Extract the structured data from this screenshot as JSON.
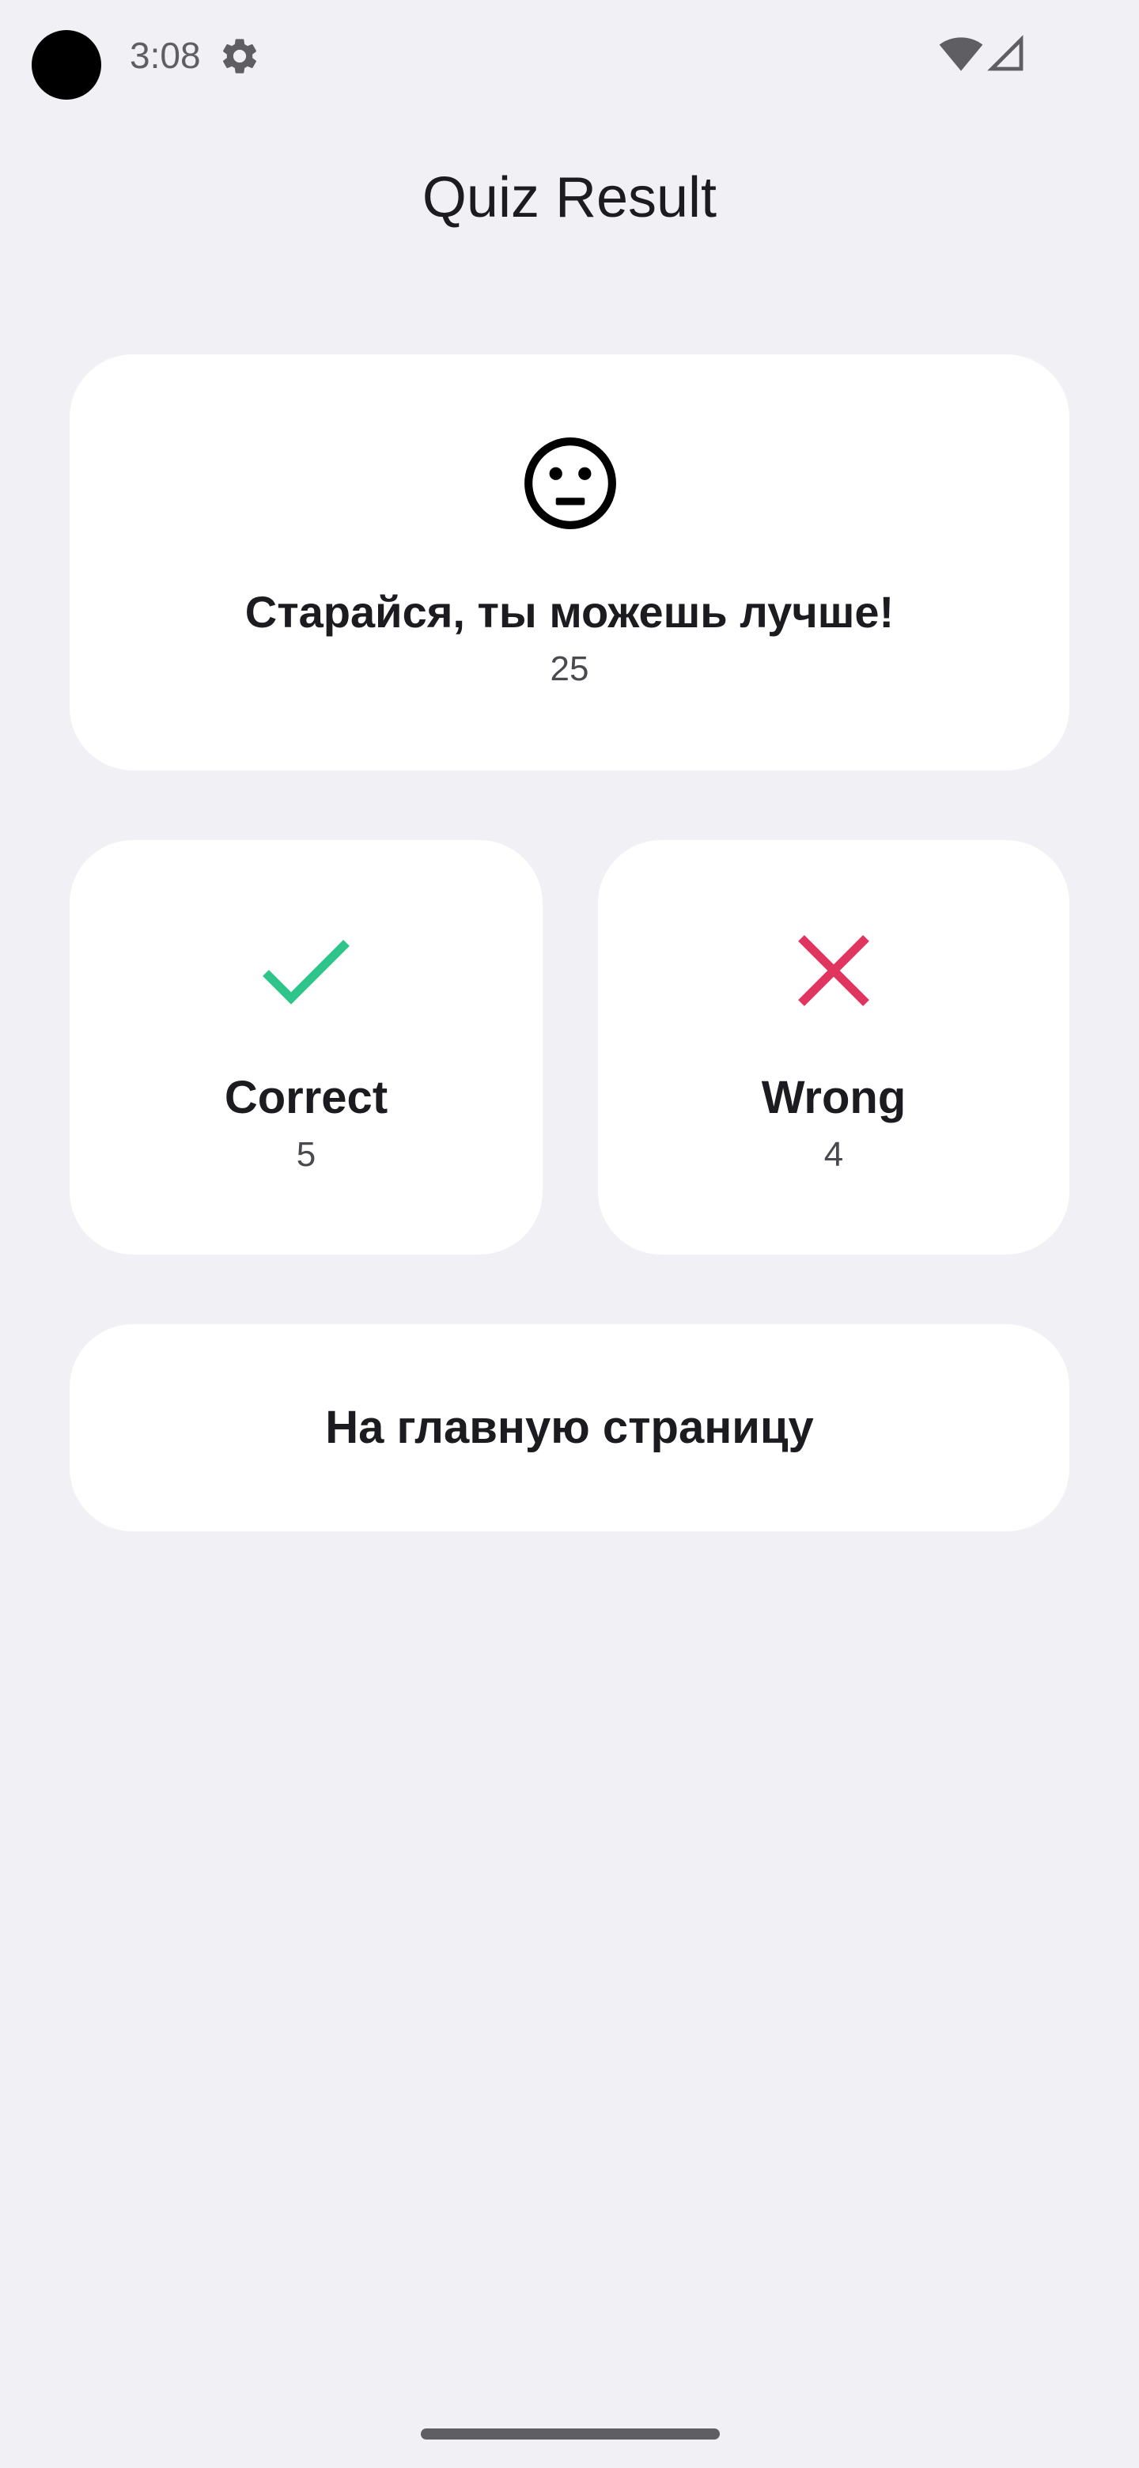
{
  "status_bar": {
    "time": "3:08",
    "icons": [
      "settings-icon",
      "wifi-icon",
      "cellular-signal-icon"
    ]
  },
  "header": {
    "title": "Quiz Result"
  },
  "summary": {
    "icon": "neutral-face-icon",
    "message": "Старайся, ты можешь лучше!",
    "score": "25"
  },
  "stats": {
    "correct": {
      "icon": "checkmark-icon",
      "label": "Correct",
      "value": "5",
      "color": "#2ec58a"
    },
    "wrong": {
      "icon": "cross-icon",
      "label": "Wrong",
      "value": "4",
      "color": "#e0355e"
    }
  },
  "actions": {
    "home_label": "На главную страницу"
  },
  "colors": {
    "background": "#f1f0f5",
    "card": "#ffffff",
    "text": "#1c1b1f"
  }
}
